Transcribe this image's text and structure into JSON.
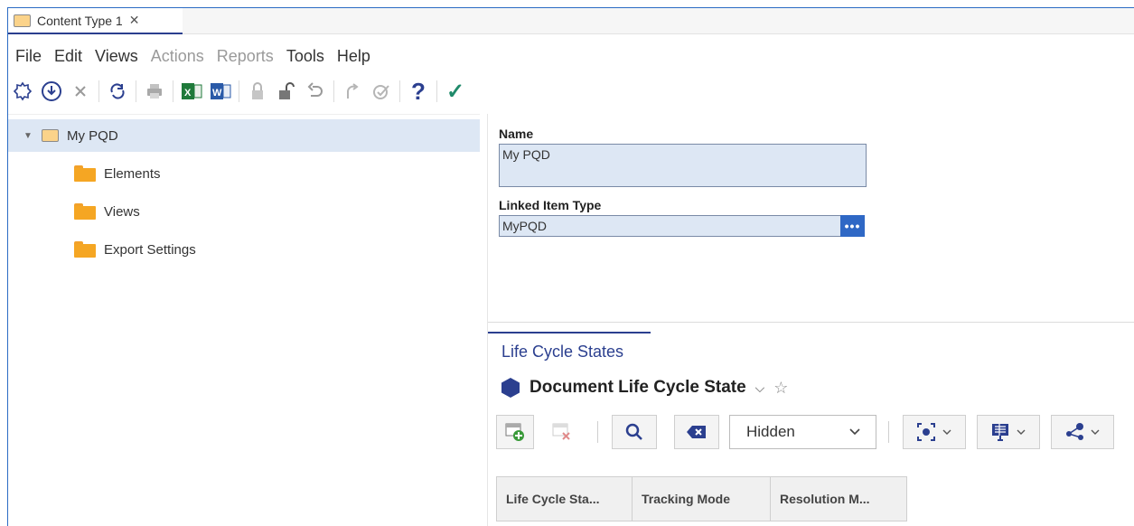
{
  "tab": {
    "label": "Content Type 1",
    "close": "✕"
  },
  "menu": [
    "File",
    "Edit",
    "Views",
    "Actions",
    "Reports",
    "Tools",
    "Help"
  ],
  "menu_disabled": [
    "Actions",
    "Reports"
  ],
  "toolbar": {
    "icons": [
      "new-item-icon",
      "download-icon",
      "delete-icon",
      "refresh-icon",
      "print-icon",
      "excel-export-icon",
      "word-export-icon",
      "lock-icon",
      "unlock-icon",
      "undo-icon",
      "redo-icon",
      "validate-icon",
      "help-icon",
      "done-icon"
    ],
    "help_glyph": "?",
    "done_glyph": "✓"
  },
  "tree": {
    "root": "My PQD",
    "children": [
      "Elements",
      "Views",
      "Export Settings"
    ]
  },
  "form": {
    "name_label": "Name",
    "name_value": "My PQD",
    "linked_label": "Linked Item Type",
    "linked_value": "MyPQD",
    "linked_button": "•••"
  },
  "lifecycle": {
    "section_title": "Life Cycle States",
    "view_name": "Document Life Cycle State",
    "view_caret": "⌵",
    "star": "☆",
    "filter_value": "Hidden",
    "columns": [
      "Life Cycle Sta...",
      "Tracking Mode",
      "Resolution M..."
    ]
  },
  "colors": {
    "accent": "#2b3f8f",
    "selection": "#dde7f4",
    "folder": "#f5a623",
    "action_blue": "#2f68c5"
  }
}
